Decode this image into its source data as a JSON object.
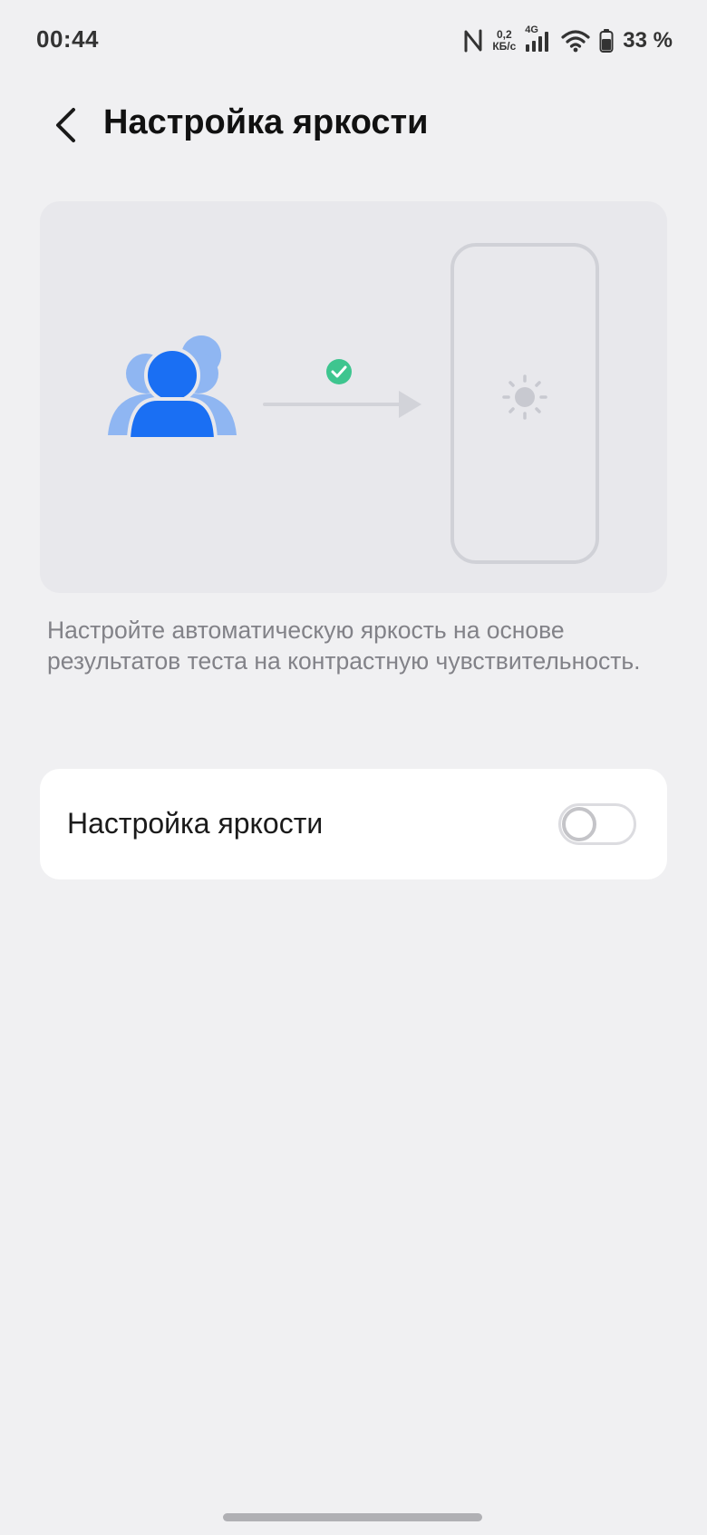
{
  "status_bar": {
    "time": "00:44",
    "net_speed_value": "0,2",
    "net_speed_unit": "КБ/с",
    "network_type": "4G",
    "battery_percent": "33 %",
    "icons": [
      "nfc-icon",
      "signal-icon",
      "wifi-icon",
      "battery-icon"
    ]
  },
  "header": {
    "title": "Настройка яркости",
    "back_icon": "chevron-left-icon"
  },
  "illustration": {
    "icons": [
      "users-icon",
      "check-circle-icon",
      "arrow-right-icon",
      "phone-outline-icon",
      "sun-icon"
    ]
  },
  "description": "Настройте автоматическую яркость на основе результатов теста на контрастную чувствительность.",
  "setting": {
    "label": "Настройка яркости",
    "toggle_on": false
  },
  "colors": {
    "background": "#f0f0f2",
    "card": "#ffffff",
    "illustration_bg": "#e8e8ec",
    "accent_blue": "#1a6ff3",
    "light_blue": "#8fb6f2",
    "check_green": "#3ec58f",
    "muted_text": "#828288"
  }
}
